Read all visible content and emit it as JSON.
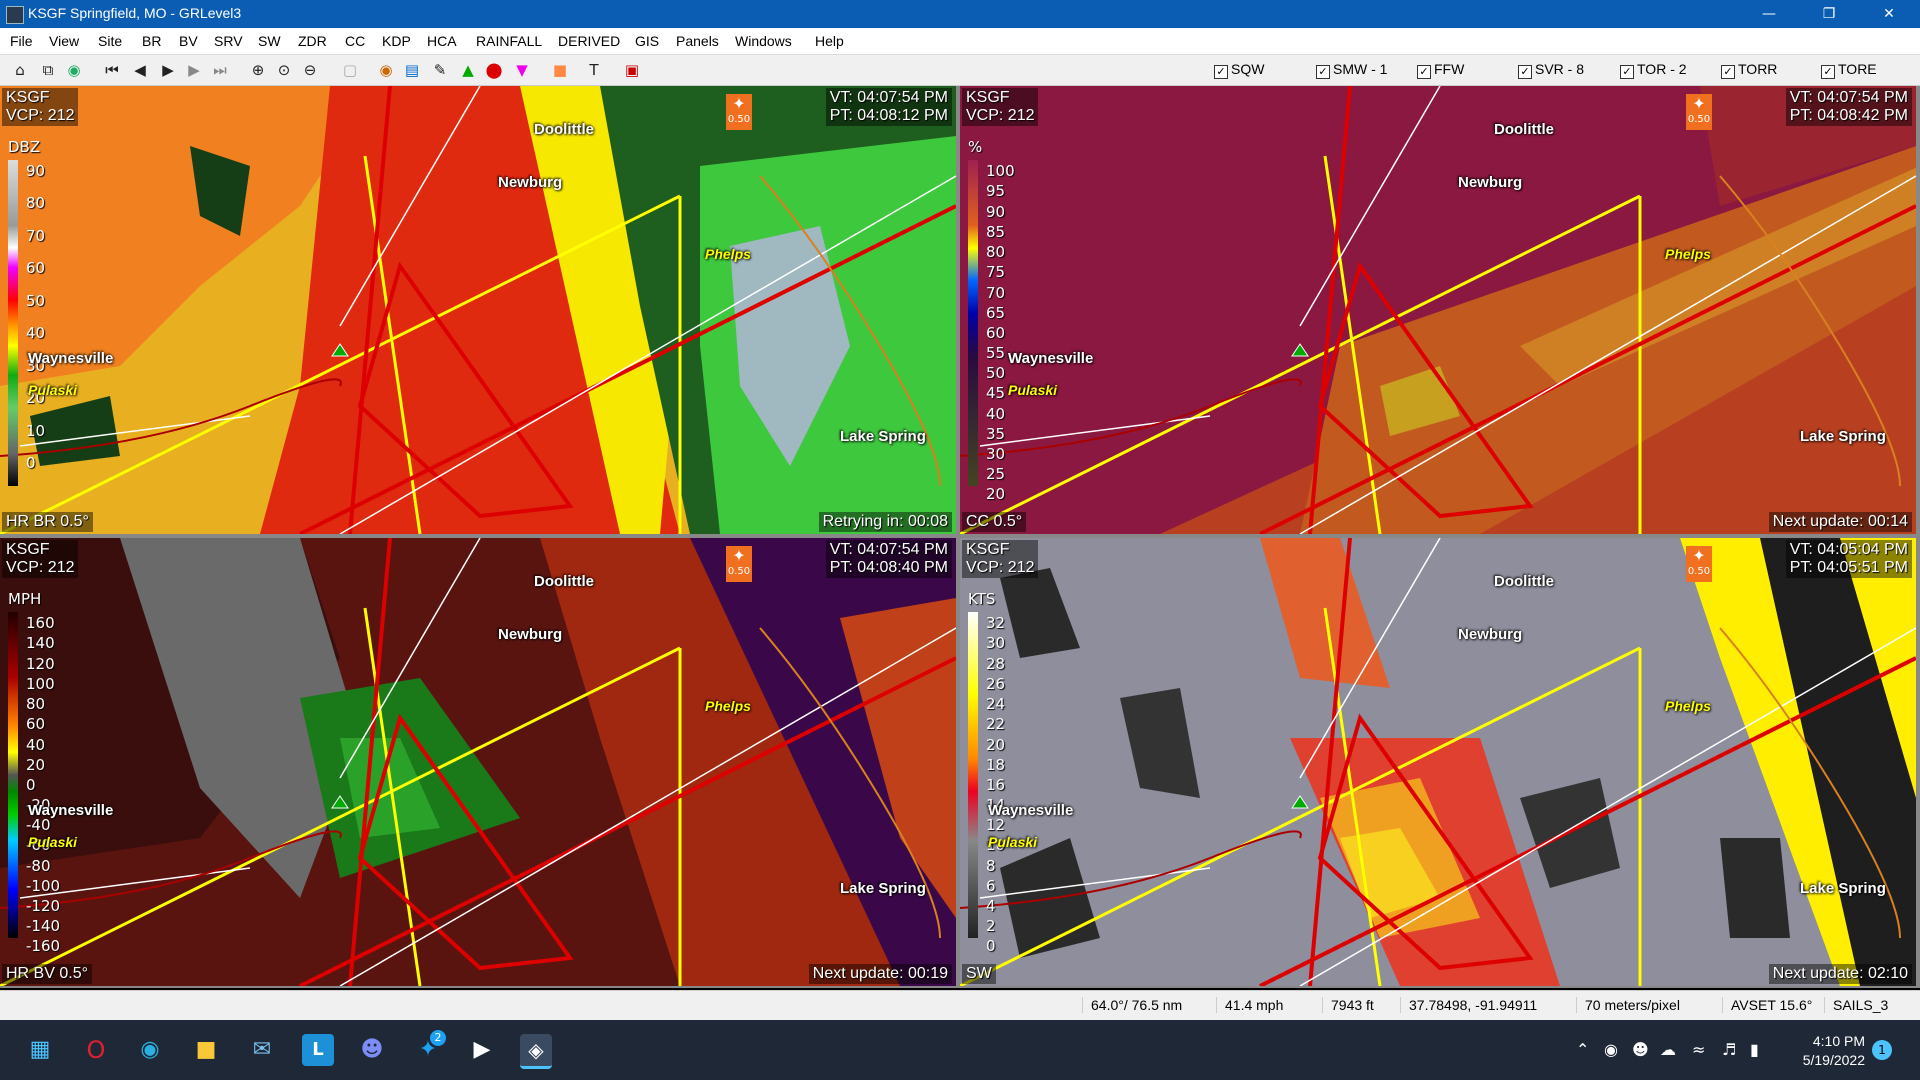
{
  "window": {
    "title": "KSGF Springfield, MO - GRLevel3"
  },
  "menu": [
    "File",
    "View",
    "Site",
    "BR",
    "BV",
    "SRV",
    "SW",
    "ZDR",
    "CC",
    "KDP",
    "HCA",
    "RAINFALL",
    "DERIVED",
    "GIS",
    "Panels",
    "Windows",
    "Help"
  ],
  "toolbar": {
    "icons": [
      "home-icon",
      "copy-icon",
      "globe-icon",
      "skip-back-icon",
      "step-back-icon",
      "play-icon",
      "step-forward-icon",
      "skip-forward-icon",
      "zoom-in-icon",
      "zoom-area-icon",
      "zoom-out-icon",
      "blank-icon",
      "color-table-icon",
      "legend-icon",
      "pencil-icon",
      "triangle-icon",
      "circle-icon",
      "triangle-down-icon",
      "square-icon",
      "text-icon",
      "stop-icon"
    ],
    "warnings": [
      {
        "label": "SQW"
      },
      {
        "label": "SMW - 1"
      },
      {
        "label": "FFW"
      },
      {
        "label": "SVR - 8"
      },
      {
        "label": "TOR - 2"
      },
      {
        "label": "TORR"
      },
      {
        "label": "TORE"
      }
    ]
  },
  "panels": [
    {
      "site": "KSGF",
      "vcp": "VCP: 212",
      "vt": "VT: 04:07:54 PM",
      "pt": "PT: 04:08:12 PM",
      "product": "HR BR 0.5°",
      "status": "Retrying in: 00:08",
      "unit": "DBZ",
      "scale": [
        "90",
        "80",
        "70",
        "60",
        "50",
        "40",
        "30",
        "20",
        "10",
        "0"
      ]
    },
    {
      "site": "KSGF",
      "vcp": "VCP: 212",
      "vt": "VT: 04:07:54 PM",
      "pt": "PT: 04:08:42 PM",
      "product": "CC 0.5°",
      "status": "Next update: 00:14",
      "unit": "%",
      "scale": [
        "100",
        "95",
        "90",
        "85",
        "80",
        "75",
        "70",
        "65",
        "60",
        "55",
        "50",
        "45",
        "40",
        "35",
        "30",
        "25",
        "20"
      ]
    },
    {
      "site": "KSGF",
      "vcp": "VCP: 212",
      "vt": "VT: 04:07:54 PM",
      "pt": "PT: 04:08:40 PM",
      "product": "HR BV 0.5°",
      "status": "Next update: 00:19",
      "unit": "MPH",
      "scale": [
        "160",
        "140",
        "120",
        "100",
        "80",
        "60",
        "40",
        "20",
        "0",
        "-20",
        "-40",
        "-60",
        "-80",
        "-100",
        "-120",
        "-140",
        "-160"
      ]
    },
    {
      "site": "KSGF",
      "vcp": "VCP: 212",
      "vt": "VT: 04:05:04 PM",
      "pt": "PT: 04:05:51 PM",
      "product": "SW",
      "status": "Next update: 02:10",
      "unit": "KTS",
      "scale": [
        "32",
        "30",
        "28",
        "26",
        "24",
        "22",
        "20",
        "18",
        "16",
        "14",
        "12",
        "10",
        "8",
        "6",
        "4",
        "2",
        "0"
      ]
    }
  ],
  "cities": {
    "doolittle": "Doolittle",
    "newburg": "Newburg",
    "phelps": "Phelps",
    "waynesville": "Waynesville",
    "pulaski": "Pulaski",
    "lake_spring": "Lake Spring"
  },
  "spotter": "0.50",
  "status": {
    "bearing": "64.0°/ 76.5 nm",
    "speed": "41.4 mph",
    "height": "7943 ft",
    "coords": "37.78498, -91.94911",
    "resolution": "70 meters/pixel",
    "avset": "AVSET 15.6°",
    "sails": "SAILS_3"
  },
  "taskbar": {
    "apps": [
      "windows-start-icon",
      "opera-icon",
      "edge-icon",
      "file-explorer-icon",
      "mail-icon",
      "l-app-icon",
      "discord-icon",
      "twitter-icon",
      "media-player-icon",
      "grlevel3-icon"
    ],
    "twitter_badge": "2",
    "time": "4:10 PM",
    "date": "5/19/2022",
    "notify_count": "1"
  }
}
